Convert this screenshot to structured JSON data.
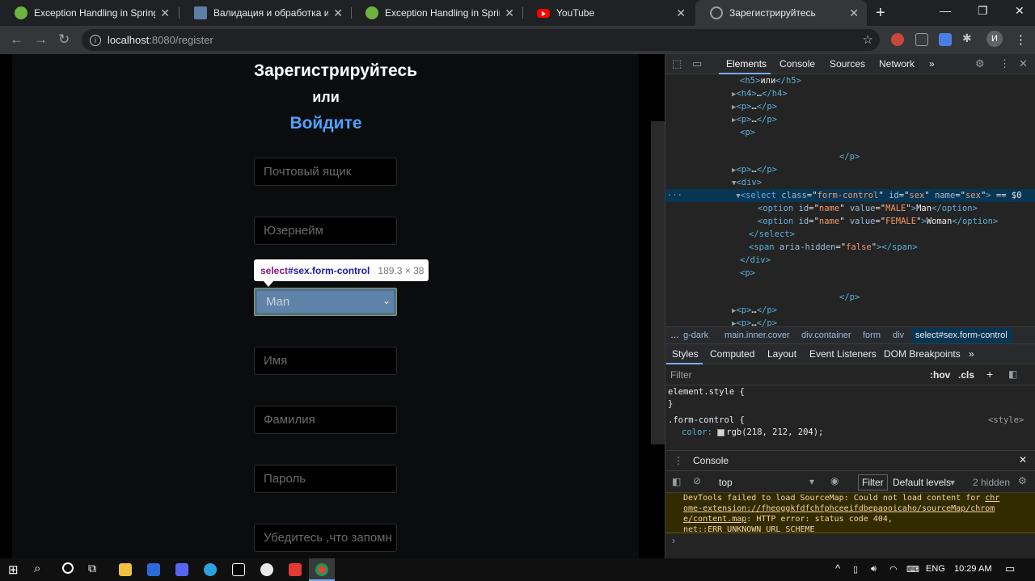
{
  "browser": {
    "tabs": [
      {
        "label": "Exception Handling in Spring M",
        "favicon": "spring-icon",
        "active": false
      },
      {
        "label": "Валидация и обработка искл",
        "favicon": "habr-icon",
        "active": false
      },
      {
        "label": "Exception Handling in Spring M",
        "favicon": "spring-icon",
        "active": false
      },
      {
        "label": "YouTube",
        "favicon": "youtube-icon",
        "active": false
      },
      {
        "label": "Зарегистрируйтесь",
        "favicon": "globe-icon",
        "active": true
      }
    ],
    "url_host": "localhost",
    "url_path": ":8080/register",
    "profile_initial": "И"
  },
  "page": {
    "title": "Зарегистрируйтесь",
    "or_text": "или",
    "login_link": "Войдите",
    "email_placeholder": "Почтовый ящик",
    "username_placeholder": "Юзернейм",
    "sex_value": "Man",
    "firstname_placeholder": "Имя",
    "lastname_placeholder": "Фамилия",
    "password_placeholder": "Пароль",
    "confirm_placeholder": "Убедитесь ,что запомн"
  },
  "inspector_tooltip": {
    "tag": "select",
    "selector": "#sex.form-control",
    "dimensions": "189.3 × 38"
  },
  "devtools": {
    "tabs": [
      "Elements",
      "Console",
      "Sources",
      "Network"
    ],
    "more": "»",
    "dom": {
      "l1_tag": "h5",
      "l1_text": "или",
      "l2": "h4",
      "l2_text": "…",
      "l3": "p",
      "l3_text": "…",
      "l4": "p",
      "l4_text": "…",
      "l5": "p",
      "l6": "p",
      "l7": "p",
      "l7_text": "…",
      "l8": "div",
      "sel_tag": "select",
      "sel_attr1": "class",
      "sel_val1": "form-control",
      "sel_attr2": "id",
      "sel_val2": "sex",
      "sel_attr3": "name",
      "sel_val3": "sex",
      "sel_suffix": " == $0",
      "opt1_id": "name",
      "opt1_value": "MALE",
      "opt1_text": "Man",
      "opt2_id": "name",
      "opt2_value": "FEMALE",
      "opt2_text": "Woman",
      "span_attr": "aria-hidden",
      "span_val": "false",
      "closing_select": "select",
      "closing_div": "div",
      "p_tag": "p",
      "closing_p": "p",
      "p_more1": "p",
      "p_more1_text": "…",
      "p_more2": "p",
      "p_more2_text": "…"
    },
    "breadcrumbs": [
      "…",
      "g-dark",
      "main.inner.cover",
      "div.container",
      "form",
      "div",
      "select#sex.form-control"
    ],
    "sub_tabs": [
      "Styles",
      "Computed",
      "Layout",
      "Event Listeners",
      "DOM Breakpoints",
      "»"
    ],
    "filter_placeholder": "Filter",
    "hov": ":hov",
    "cls": ".cls",
    "styles": {
      "element_style": "element.style {",
      "close_brace": "}",
      "form_control": ".form-control {",
      "source": "<style>",
      "color_prop": "color:",
      "color_val": "rgb(218, 212, 204);"
    },
    "console": {
      "title": "Console",
      "context": "top",
      "filter": "Filter",
      "levels": "Default levels",
      "hidden": "2 hidden",
      "warning_line1": "DevTools failed to load SourceMap: Could not load content for ",
      "warning_link1": "chr",
      "warning_link2": "ome-extension://fheoggkfdfchfphceeifdbepaooicaho/sourceMap/chrom",
      "warning_link3": "e/content.map",
      "warning_rest": ": HTTP error: status code 404,",
      "warning_line4": "net::ERR_UNKNOWN_URL_SCHEME",
      "prompt": "›"
    }
  },
  "taskbar": {
    "language": "ENG",
    "time": "10:29 AM"
  }
}
